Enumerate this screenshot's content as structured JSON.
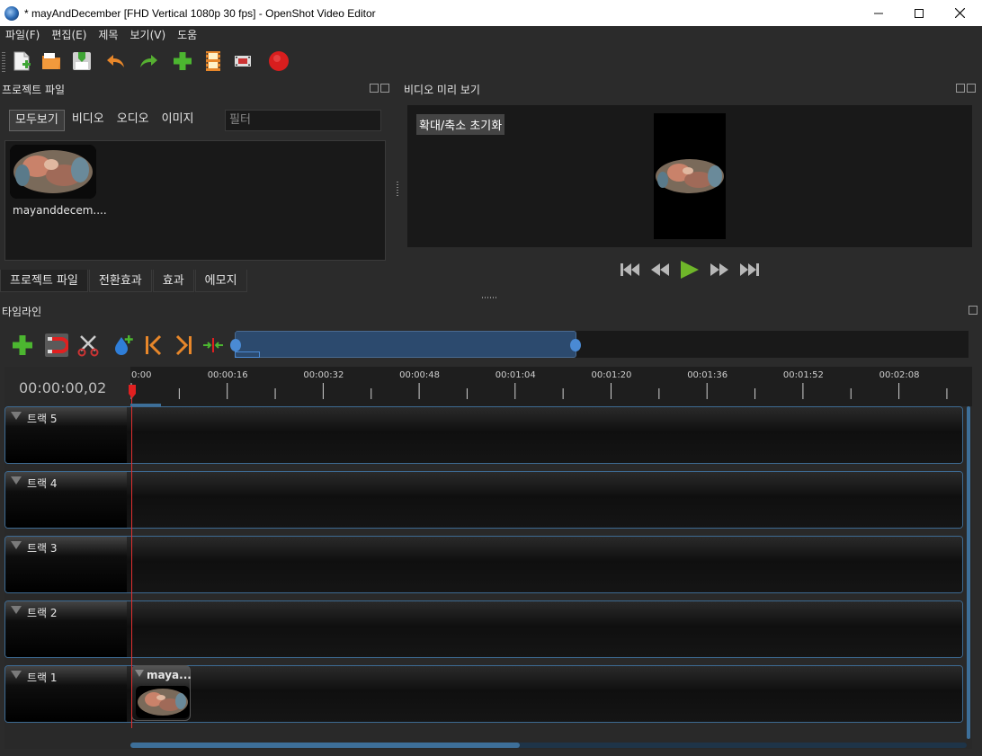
{
  "window": {
    "title": "* mayAndDecember [FHD Vertical 1080p 30 fps] - OpenShot Video Editor",
    "minimize": "—",
    "maximize": "☐",
    "close": "✕"
  },
  "menu": [
    "파일(F)",
    "편집(E)",
    "제목",
    "보기(V)",
    "도움"
  ],
  "toolbar": {
    "icons": [
      "new-project-icon",
      "open-project-icon",
      "save-project-icon",
      "undo-icon",
      "redo-icon",
      "import-files-icon",
      "profile-icon",
      "export-film-icon",
      "record-icon"
    ]
  },
  "project_files": {
    "title": "프로젝트 파일",
    "filters": [
      "모두보기",
      "비디오",
      "오디오",
      "이미지"
    ],
    "filter_placeholder": "필터",
    "files": [
      {
        "name": "mayanddecem...."
      }
    ]
  },
  "bottom_tabs": [
    "프로젝트 파일",
    "전환효과",
    "효과",
    "에모지"
  ],
  "preview": {
    "title": "비디오 미리 보기",
    "zoom_reset": "확대/축소 초기화"
  },
  "timeline": {
    "title": "타임라인",
    "time": "00:00:00,02",
    "ruler_labels": [
      "0:00",
      "00:00:16",
      "00:00:32",
      "00:00:48",
      "00:01:04",
      "00:01:20",
      "00:01:36",
      "00:01:52",
      "00:02:08"
    ],
    "tracks": [
      "트랙 5",
      "트랙 4",
      "트랙 3",
      "트랙 2",
      "트랙 1"
    ],
    "clip": {
      "title": "maya...",
      "track": "트랙 1"
    }
  },
  "colors": {
    "accent": "#3d6f99",
    "playhead": "#e03030",
    "background": "#2b2b2b"
  }
}
